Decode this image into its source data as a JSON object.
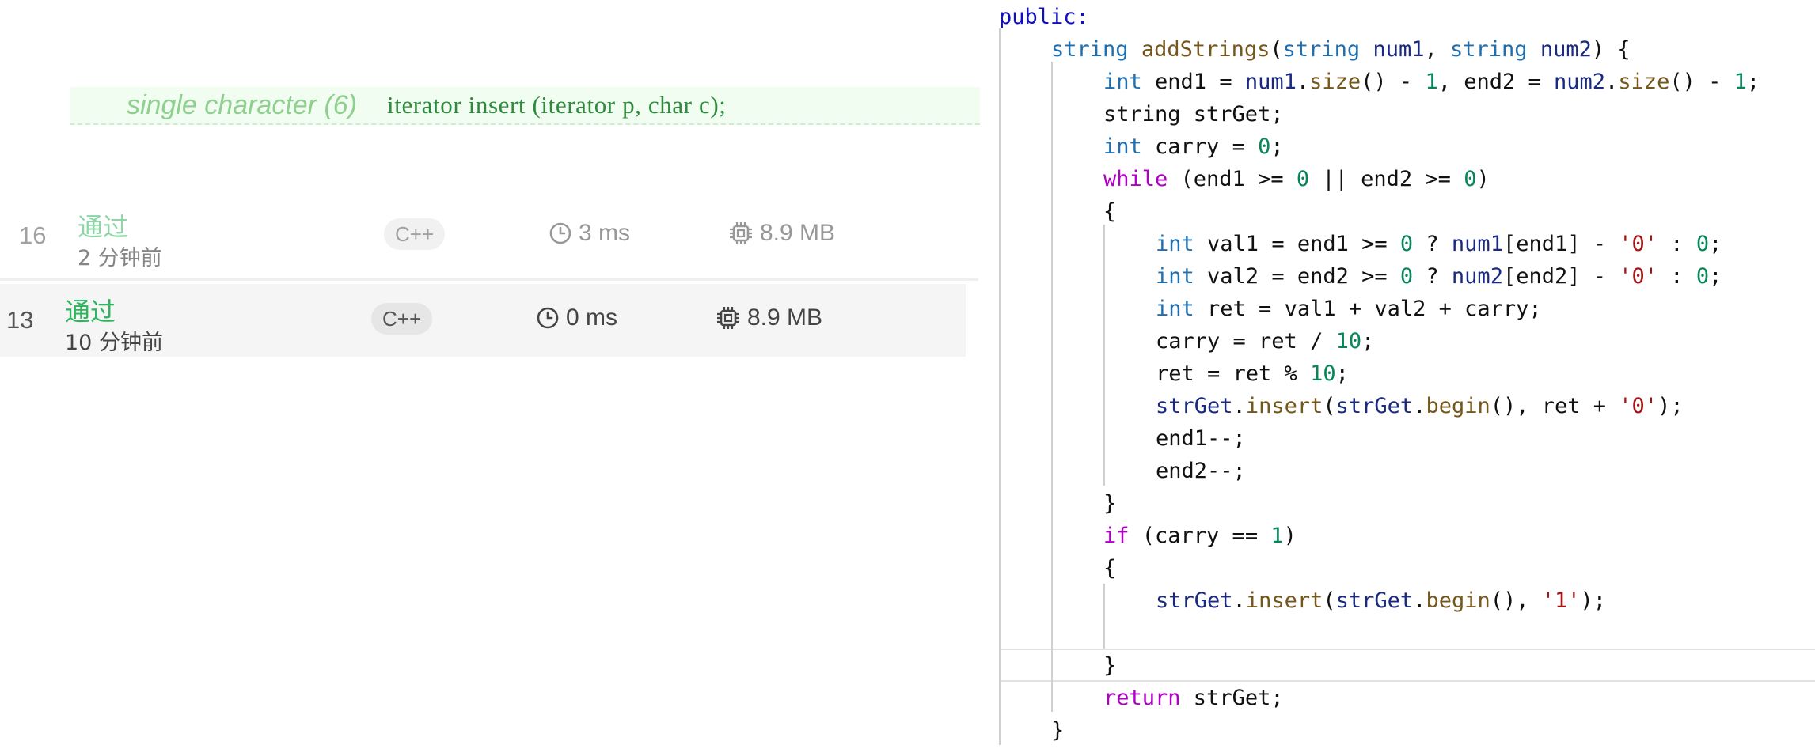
{
  "signature": {
    "label": "single character (6)",
    "code": "iterator insert (iterator p, char c);"
  },
  "submissions": [
    {
      "number": "16",
      "status": "通过",
      "time_ago": "2 分钟前",
      "language": "C++",
      "runtime": "3 ms",
      "memory": "8.9 MB"
    },
    {
      "number": "13",
      "status": "通过",
      "time_ago": "10 分钟前",
      "language": "C++",
      "runtime": "0 ms",
      "memory": "8.9 MB"
    }
  ],
  "colors": {
    "accepted": "#2db55d",
    "badge_bg": "#e6e6e6",
    "sig_bg": "#f0fdf0"
  },
  "icons": {
    "runtime": "clock-icon",
    "memory": "cpu-chip-icon"
  },
  "code_lines": [
    {
      "indent": 0,
      "tokens": [
        [
          "kw-public",
          "public:"
        ]
      ]
    },
    {
      "indent": 1,
      "tokens": [
        [
          "type",
          "string"
        ],
        [
          "plain",
          " "
        ],
        [
          "fn",
          "addStrings"
        ],
        [
          "plain",
          "("
        ],
        [
          "type",
          "string"
        ],
        [
          "plain",
          " "
        ],
        [
          "var",
          "num1"
        ],
        [
          "plain",
          ", "
        ],
        [
          "type",
          "string"
        ],
        [
          "plain",
          " "
        ],
        [
          "var",
          "num2"
        ],
        [
          "plain",
          ") {"
        ]
      ]
    },
    {
      "indent": 2,
      "tokens": [
        [
          "type",
          "int"
        ],
        [
          "plain",
          " end1 = "
        ],
        [
          "var",
          "num1"
        ],
        [
          "plain",
          "."
        ],
        [
          "fn",
          "size"
        ],
        [
          "plain",
          "() - "
        ],
        [
          "num",
          "1"
        ],
        [
          "plain",
          ", end2 = "
        ],
        [
          "var",
          "num2"
        ],
        [
          "plain",
          "."
        ],
        [
          "fn",
          "size"
        ],
        [
          "plain",
          "() - "
        ],
        [
          "num",
          "1"
        ],
        [
          "plain",
          ";"
        ]
      ]
    },
    {
      "indent": 2,
      "tokens": [
        [
          "plain",
          "string strGet;"
        ]
      ]
    },
    {
      "indent": 2,
      "tokens": [
        [
          "type",
          "int"
        ],
        [
          "plain",
          " carry = "
        ],
        [
          "num",
          "0"
        ],
        [
          "plain",
          ";"
        ]
      ]
    },
    {
      "indent": 2,
      "tokens": [
        [
          "ctl",
          "while"
        ],
        [
          "plain",
          " (end1 >= "
        ],
        [
          "num",
          "0"
        ],
        [
          "plain",
          " || end2 >= "
        ],
        [
          "num",
          "0"
        ],
        [
          "plain",
          ")"
        ]
      ]
    },
    {
      "indent": 2,
      "tokens": [
        [
          "plain",
          "{"
        ]
      ]
    },
    {
      "indent": 3,
      "tokens": [
        [
          "type",
          "int"
        ],
        [
          "plain",
          " val1 = end1 >= "
        ],
        [
          "num",
          "0"
        ],
        [
          "plain",
          " ? "
        ],
        [
          "var",
          "num1"
        ],
        [
          "plain",
          "[end1] - "
        ],
        [
          "chr",
          "'0'"
        ],
        [
          "plain",
          " : "
        ],
        [
          "num",
          "0"
        ],
        [
          "plain",
          ";"
        ]
      ]
    },
    {
      "indent": 3,
      "tokens": [
        [
          "type",
          "int"
        ],
        [
          "plain",
          " val2 = end2 >= "
        ],
        [
          "num",
          "0"
        ],
        [
          "plain",
          " ? "
        ],
        [
          "var",
          "num2"
        ],
        [
          "plain",
          "[end2] - "
        ],
        [
          "chr",
          "'0'"
        ],
        [
          "plain",
          " : "
        ],
        [
          "num",
          "0"
        ],
        [
          "plain",
          ";"
        ]
      ]
    },
    {
      "indent": 3,
      "tokens": [
        [
          "type",
          "int"
        ],
        [
          "plain",
          " ret = val1 + val2 + carry;"
        ]
      ]
    },
    {
      "indent": 3,
      "tokens": [
        [
          "plain",
          "carry = ret / "
        ],
        [
          "num",
          "10"
        ],
        [
          "plain",
          ";"
        ]
      ]
    },
    {
      "indent": 3,
      "tokens": [
        [
          "plain",
          "ret = ret % "
        ],
        [
          "num",
          "10"
        ],
        [
          "plain",
          ";"
        ]
      ]
    },
    {
      "indent": 3,
      "tokens": [
        [
          "var",
          "strGet"
        ],
        [
          "plain",
          "."
        ],
        [
          "fn",
          "insert"
        ],
        [
          "plain",
          "("
        ],
        [
          "var",
          "strGet"
        ],
        [
          "plain",
          "."
        ],
        [
          "fn",
          "begin"
        ],
        [
          "plain",
          "(), ret + "
        ],
        [
          "chr",
          "'0'"
        ],
        [
          "plain",
          ");"
        ]
      ]
    },
    {
      "indent": 3,
      "tokens": [
        [
          "plain",
          "end1--;"
        ]
      ]
    },
    {
      "indent": 3,
      "tokens": [
        [
          "plain",
          "end2--;"
        ]
      ]
    },
    {
      "indent": 2,
      "tokens": [
        [
          "plain",
          "}"
        ]
      ]
    },
    {
      "indent": 2,
      "tokens": [
        [
          "ctl",
          "if"
        ],
        [
          "plain",
          " (carry == "
        ],
        [
          "num",
          "1"
        ],
        [
          "plain",
          ")"
        ]
      ]
    },
    {
      "indent": 2,
      "tokens": [
        [
          "plain",
          "{"
        ]
      ]
    },
    {
      "indent": 3,
      "tokens": [
        [
          "var",
          "strGet"
        ],
        [
          "plain",
          "."
        ],
        [
          "fn",
          "insert"
        ],
        [
          "plain",
          "("
        ],
        [
          "var",
          "strGet"
        ],
        [
          "plain",
          "."
        ],
        [
          "fn",
          "begin"
        ],
        [
          "plain",
          "(), "
        ],
        [
          "chr",
          "'1'"
        ],
        [
          "plain",
          ");"
        ]
      ]
    },
    {
      "indent": 3,
      "tokens": []
    },
    {
      "indent": 2,
      "tokens": [
        [
          "plain",
          "}"
        ]
      ]
    },
    {
      "indent": 2,
      "tokens": [
        [
          "ctl",
          "return"
        ],
        [
          "plain",
          " strGet;"
        ]
      ]
    },
    {
      "indent": 1,
      "tokens": [
        [
          "plain",
          "}"
        ]
      ]
    }
  ]
}
